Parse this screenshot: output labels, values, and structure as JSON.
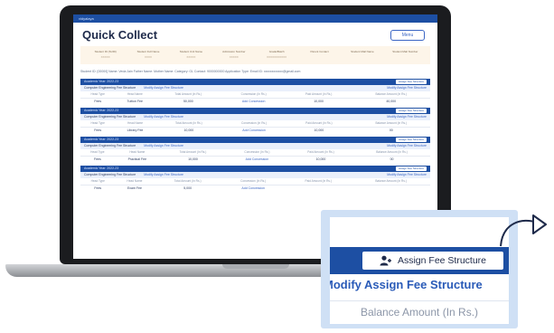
{
  "app": {
    "topbar_label": "vidyalaya",
    "page_title": "Quick Collect",
    "menu_label": "Menu"
  },
  "summary": [
    {
      "label": "Student ID (SUID)",
      "value": "XXXXX"
    },
    {
      "label": "Student Full Name",
      "value": "XXXX"
    },
    {
      "label": "Student Unit Name",
      "value": "XXXXX"
    },
    {
      "label": "Admission Number",
      "value": "XXXXX"
    },
    {
      "label": "Grade/Batch",
      "value": "XXXXXXXXXXX"
    },
    {
      "label": "Parent Contact",
      "value": ""
    },
    {
      "label": "Student Mail Name",
      "value": ""
    },
    {
      "label": "Student Mail Number",
      "value": ""
    }
  ],
  "student_line": "Student ID: [00000]  Name: Veda Jain  Father Name:  Mother Name:  Category: GL  Contact: 9000000000  Application Type:  Email ID: xxxxxxxxxxxx@gmail.com",
  "sections": [
    {
      "academic_year": "Academic Year: 2022-23",
      "assign_label": "Assign Fee Structure",
      "course": "Computer Engineering Fee Structure",
      "modify_left": "Modify Assign Fee Structure",
      "modify_right": "Modify Assign Fee Structure",
      "headers": [
        "Head Type",
        "Head Name",
        "Total Amount (In Rs.)",
        "Concession (In Rs.)",
        "Paid Amount (In Rs.)",
        "Balance Amount (In Rs.)"
      ],
      "row": [
        "Fees",
        "Tuition Fee",
        "50,000",
        "Add Concession",
        "10,000",
        "40,000"
      ]
    },
    {
      "academic_year": "Academic Year: 2022-23",
      "assign_label": "Assign Fee Structure",
      "course": "Computer Engineering Fee Structure",
      "modify_left": "Modify Assign Fee Structure",
      "modify_right": "Modify Assign Fee Structure",
      "headers": [
        "Head Type",
        "Head Name",
        "Total Amount (In Rs.)",
        "Concession (In Rs.)",
        "Paid Amount (In Rs.)",
        "Balance Amount (In Rs.)"
      ],
      "row": [
        "Fees",
        "Library Fee",
        "10,000",
        "Add Concession",
        "10,000",
        "00"
      ]
    },
    {
      "academic_year": "Academic Year: 2022-23",
      "assign_label": "Assign Fee Structure",
      "course": "Computer Engineering Fee Structure",
      "modify_left": "Modify Assign Fee Structure",
      "modify_right": "Modify Assign Fee Structure",
      "headers": [
        "Head Type",
        "Head Name",
        "Total Amount (In Rs.)",
        "Concession (In Rs.)",
        "Paid Amount (In Rs.)",
        "Balance Amount (In Rs.)"
      ],
      "row": [
        "Fees",
        "Practical Fee",
        "10,000",
        "Add Concession",
        "10,000",
        "00"
      ]
    },
    {
      "academic_year": "Academic Year: 2022-23",
      "assign_label": "Assign Fee Structure",
      "course": "Computer Engineering Fee Structure",
      "modify_left": "Modify Assign Fee Structure",
      "modify_right": "Modify Assign Fee Structure",
      "headers": [
        "Head Type",
        "Head Name",
        "Total Amount (In Rs.)",
        "Concession (In Rs.)",
        "Paid Amount (In Rs.)",
        "Balance Amount (In Rs.)"
      ],
      "row": [
        "Fees",
        "Exam Fee",
        "5,000",
        "Add Concession",
        "",
        ""
      ]
    }
  ],
  "zoom": {
    "assign_label": "Assign Fee Structure",
    "modify_label": "Modify Assign Fee Structure",
    "balance_label": "Balance Amount (In Rs.)",
    "icon": "user-plus-icon"
  },
  "colors": {
    "primary": "#1d4fa3",
    "link": "#3b66c4",
    "summary_bg": "#fdf5e9"
  }
}
